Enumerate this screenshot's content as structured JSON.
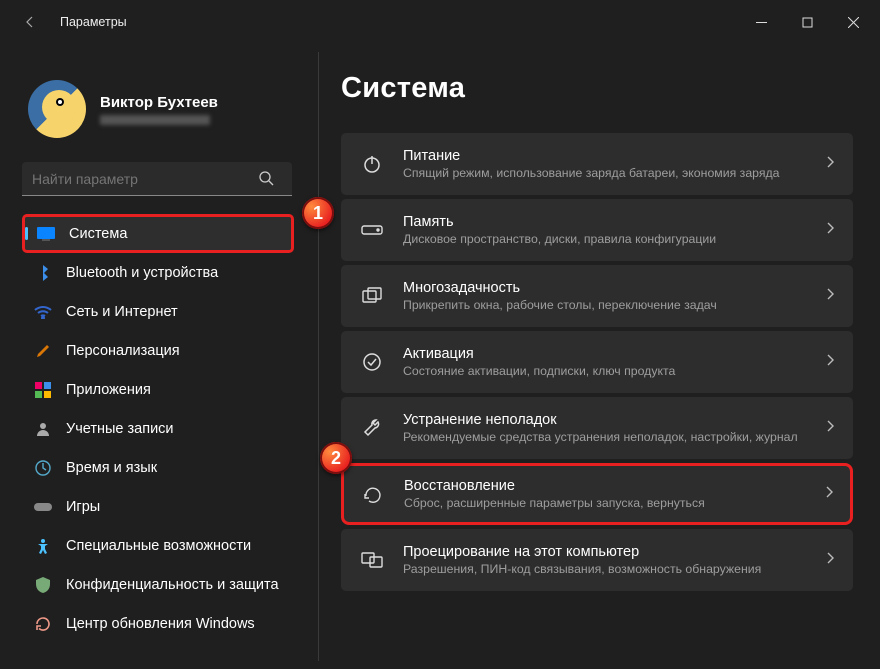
{
  "window": {
    "title": "Параметры",
    "minimize": "—",
    "maximize": "☐",
    "close": "✕",
    "back": "←"
  },
  "profile": {
    "name": "Виктор Бухтеев"
  },
  "search": {
    "placeholder": "Найти параметр"
  },
  "badges": {
    "b1": "1",
    "b2": "2"
  },
  "nav": [
    {
      "label": "Система",
      "icon": "monitor",
      "selected": true
    },
    {
      "label": "Bluetooth и устройства",
      "icon": "bluetooth"
    },
    {
      "label": "Сеть и Интернет",
      "icon": "wifi"
    },
    {
      "label": "Персонализация",
      "icon": "brush"
    },
    {
      "label": "Приложения",
      "icon": "apps"
    },
    {
      "label": "Учетные записи",
      "icon": "person"
    },
    {
      "label": "Время и язык",
      "icon": "globe-clock"
    },
    {
      "label": "Игры",
      "icon": "game"
    },
    {
      "label": "Специальные возможности",
      "icon": "accessibility"
    },
    {
      "label": "Конфиденциальность и защита",
      "icon": "shield"
    },
    {
      "label": "Центр обновления Windows",
      "icon": "update"
    }
  ],
  "page": {
    "title": "Система"
  },
  "cards": [
    {
      "icon": "power",
      "title": "Питание",
      "desc": "Спящий режим, использование заряда батареи, экономия заряда"
    },
    {
      "icon": "storage",
      "title": "Память",
      "desc": "Дисковое пространство, диски, правила конфигурации"
    },
    {
      "icon": "multitask",
      "title": "Многозадачность",
      "desc": "Прикрепить окна, рабочие столы, переключение задач"
    },
    {
      "icon": "check-badge",
      "title": "Активация",
      "desc": "Состояние активации, подписки, ключ продукта"
    },
    {
      "icon": "wrench",
      "title": "Устранение неполадок",
      "desc": "Рекомендуемые средства устранения неполадок, настройки, журнал"
    },
    {
      "icon": "recovery",
      "title": "Восстановление",
      "desc": "Сброс, расширенные параметры запуска, вернуться",
      "highlight": true
    },
    {
      "icon": "project",
      "title": "Проецирование на этот компьютер",
      "desc": "Разрешения, ПИН-код связывания, возможность обнаружения"
    }
  ]
}
